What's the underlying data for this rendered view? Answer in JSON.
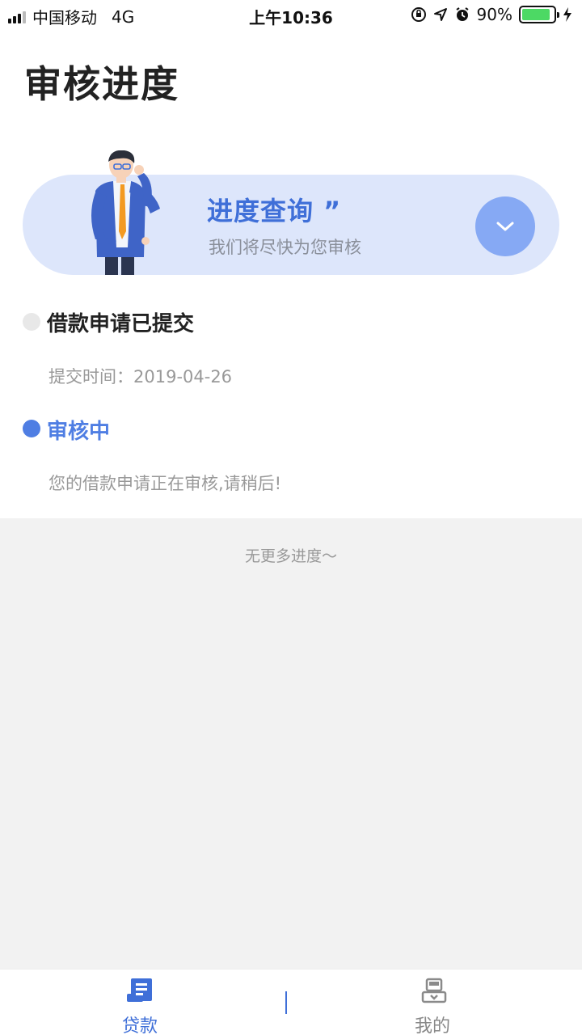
{
  "status_bar": {
    "carrier": "中国移动",
    "network": "4G",
    "time": "上午10:36",
    "battery_percent": "90%",
    "battery_level": 0.9
  },
  "page": {
    "title": "审核进度"
  },
  "banner": {
    "heading": "进度查询 ”",
    "subtitle": "我们将尽快为您审核",
    "accent_color": "#3f6fd8",
    "background_color": "#dde6fb"
  },
  "timeline": {
    "steps": [
      {
        "title": "借款申请已提交",
        "description": "提交时间：2019-04-26",
        "status": "done"
      },
      {
        "title": "审核中",
        "description": "您的借款申请正在审核,请稍后!",
        "status": "active"
      }
    ],
    "end_text": "无更多进度～"
  },
  "tab_bar": {
    "tabs": [
      {
        "label": "贷款",
        "icon": "document-icon",
        "active": true
      },
      {
        "label": "我的",
        "icon": "user-profile-icon",
        "active": false
      }
    ]
  },
  "colors": {
    "primary": "#4f7ee3",
    "inactive": "#888888",
    "page_background": "#f2f2f2"
  }
}
